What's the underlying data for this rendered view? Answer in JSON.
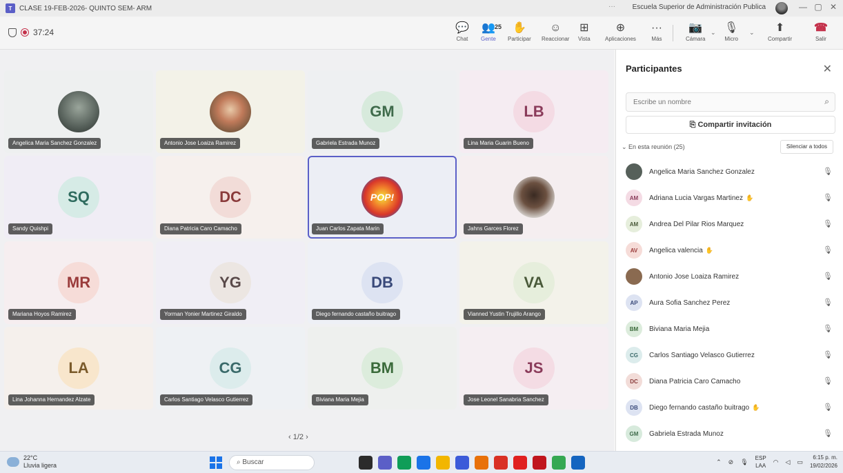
{
  "window": {
    "title": "CLASE 19-FEB-2026- QUINTO SEM- ARM",
    "org": "Escuela Superior de Administración Publica",
    "dots": "···",
    "minimize": "—",
    "restore": "▢",
    "close": "✕"
  },
  "meeting": {
    "timer": "37:24",
    "people_count": "25",
    "toolbar": [
      {
        "label": "Chat",
        "icon": "chat-icon",
        "glyph": "💬"
      },
      {
        "label": "Gente",
        "icon": "people-icon",
        "glyph": "👥"
      },
      {
        "label": "Participar",
        "icon": "hand-icon",
        "glyph": "✋"
      },
      {
        "label": "Reaccionar",
        "icon": "emoji-icon",
        "glyph": "☺"
      },
      {
        "label": "Vista",
        "icon": "grid-icon",
        "glyph": "⊞"
      },
      {
        "label": "Aplicaciones",
        "icon": "apps-icon",
        "glyph": "⊕"
      },
      {
        "label": "Más",
        "icon": "more-icon",
        "glyph": "···"
      },
      {
        "label": "Cámara",
        "icon": "camera-off-icon",
        "glyph": "📷"
      },
      {
        "label": "Micro",
        "icon": "mic-off-icon",
        "glyph": "🎙"
      },
      {
        "label": "Compartir",
        "icon": "share-icon",
        "glyph": "⬆"
      },
      {
        "label": "Salir",
        "icon": "leave-icon",
        "glyph": "☎"
      }
    ]
  },
  "tiles": [
    {
      "initials": "",
      "name": "Angelica Maria Sanchez Gonzalez",
      "kind": "photo",
      "bg": "#eef0f0"
    },
    {
      "initials": "",
      "name": "Antonio Jose Loaiza Ramirez",
      "kind": "photo2",
      "bg": "#f3f2e8"
    },
    {
      "initials": "GM",
      "name": "Gabriela Estrada Munoz",
      "kind": "init",
      "bg": "#eef0f2",
      "avbg": "#d7eadc",
      "avcolor": "#3f6b4b"
    },
    {
      "initials": "LB",
      "name": "Lina Maria Guarin Bueno",
      "kind": "init",
      "bg": "#f5ecf2",
      "avbg": "#f4dbe4",
      "avcolor": "#8a3b5a"
    },
    {
      "initials": "SQ",
      "name": "Sandy Quishpi",
      "kind": "init",
      "bg": "#f0edf5",
      "avbg": "#d6ebe6",
      "avcolor": "#2e6b5e"
    },
    {
      "initials": "DC",
      "name": "Diana Patricia Caro Camacho",
      "kind": "init",
      "bg": "#f6f0ed",
      "avbg": "#f2dcd8",
      "avcolor": "#8a3b3b"
    },
    {
      "initials": "",
      "name": "Juan Carlos Zapata Marin",
      "kind": "photo3",
      "bg": "#eceef5",
      "label": "POP!"
    },
    {
      "initials": "",
      "name": "Jahns Garces Florez",
      "kind": "photo4",
      "bg": "#f5eef0"
    },
    {
      "initials": "MR",
      "name": "Mariana Hoyos Ramirez",
      "kind": "init",
      "bg": "#f6eef0",
      "avbg": "#f6dcd8",
      "avcolor": "#9a3b3b"
    },
    {
      "initials": "YG",
      "name": "Yorman Yonier Martinez Giraldo",
      "kind": "init",
      "bg": "#f0eef5",
      "avbg": "#ece6e2",
      "avcolor": "#5a4a4a"
    },
    {
      "initials": "DB",
      "name": "Diego fernando castaño buitrago",
      "kind": "init",
      "bg": "#eef0f6",
      "avbg": "#dde3f2",
      "avcolor": "#3a4a7a"
    },
    {
      "initials": "VA",
      "name": "Vianned Yustin Trujillo Arango",
      "kind": "init",
      "bg": "#f3f2ea",
      "avbg": "#e6eedc",
      "avcolor": "#4a5a3a"
    },
    {
      "initials": "LA",
      "name": "Lina Johanna Hernandez Alzate",
      "kind": "init",
      "bg": "#f5f0ec",
      "avbg": "#f8e6cc",
      "avcolor": "#7a5a2a"
    },
    {
      "initials": "CG",
      "name": "Carlos Santiago Velasco Gutierrez",
      "kind": "init",
      "bg": "#eef1f4",
      "avbg": "#dcecec",
      "avcolor": "#3a6a6a"
    },
    {
      "initials": "BM",
      "name": "Biviana Maria Mejia",
      "kind": "init",
      "bg": "#eef0ee",
      "avbg": "#dcecdc",
      "avcolor": "#3a6a3a"
    },
    {
      "initials": "JS",
      "name": "Jose Leonel Sanabria Sanchez",
      "kind": "init",
      "bg": "#f5eef2",
      "avbg": "#f4dce4",
      "avcolor": "#8a3b5a"
    }
  ],
  "pager": "‹  1/2  ›",
  "panel": {
    "title": "Participantes",
    "search_placeholder": "Escribe un nombre",
    "share_label": "Compartir invitación",
    "section_label": "En esta reunión (25)",
    "mute_all_label": "Silenciar a todos",
    "participants": [
      {
        "initials": "",
        "name": "Angelica Maria Sanchez Gonzalez",
        "avbg": "#56605a",
        "avcolor": "#fff",
        "hand": false
      },
      {
        "initials": "AM",
        "name": "Adriana Lucia Vargas Martinez",
        "avbg": "#f4dbe4",
        "avcolor": "#8a3b5a",
        "hand": true
      },
      {
        "initials": "AM",
        "name": "Andrea Del Pilar Rios Marquez",
        "avbg": "#e6eedc",
        "avcolor": "#4a5a3a",
        "hand": false
      },
      {
        "initials": "AV",
        "name": "Angelica valencia",
        "avbg": "#f6dcd8",
        "avcolor": "#9a3b3b",
        "hand": true
      },
      {
        "initials": "",
        "name": "Antonio Jose Loaiza Ramirez",
        "avbg": "#8a6a50",
        "avcolor": "#fff",
        "hand": false
      },
      {
        "initials": "AP",
        "name": "Aura Sofia Sanchez Perez",
        "avbg": "#dde3f2",
        "avcolor": "#3a4a7a",
        "hand": false
      },
      {
        "initials": "BM",
        "name": "Biviana Maria Mejia",
        "avbg": "#dcecdc",
        "avcolor": "#3a6a3a",
        "hand": false
      },
      {
        "initials": "CG",
        "name": "Carlos Santiago Velasco Gutierrez",
        "avbg": "#dcecec",
        "avcolor": "#3a6a6a",
        "hand": false
      },
      {
        "initials": "DC",
        "name": "Diana Patricia Caro Camacho",
        "avbg": "#f2dcd8",
        "avcolor": "#8a3b3b",
        "hand": false
      },
      {
        "initials": "DB",
        "name": "Diego fernando castaño buitrago",
        "avbg": "#dde3f2",
        "avcolor": "#3a4a7a",
        "hand": true
      },
      {
        "initials": "GM",
        "name": "Gabriela Estrada Munoz",
        "avbg": "#d7eadc",
        "avcolor": "#3f6b4b",
        "hand": false
      }
    ]
  },
  "taskbar": {
    "temp": "22°C",
    "weather": "Lluvia ligera",
    "search": "Buscar",
    "lang_top": "ESP",
    "lang_bottom": "LAA",
    "time": "6:15 p. m.",
    "date": "19/02/2026"
  }
}
